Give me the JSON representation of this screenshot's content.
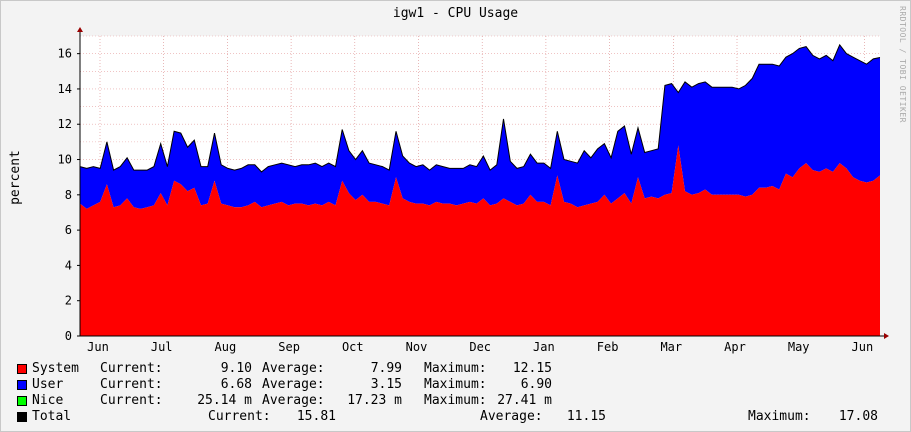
{
  "title": "igw1 - CPU Usage",
  "watermark": "RRDTOOL / TOBI OETIKER",
  "colors": {
    "system": "#ff0000",
    "user": "#0000ff",
    "nice": "#00ff00",
    "total": "#000000",
    "grid_minor": "#e6a0a0",
    "grid_major": "#d98888"
  },
  "chart_data": {
    "type": "area",
    "title": "igw1 - CPU Usage",
    "ylabel": "percent",
    "xlabel": "",
    "ylim": [
      0,
      17
    ],
    "yticks": [
      0,
      2,
      4,
      6,
      8,
      10,
      12,
      14,
      16
    ],
    "x_month_labels": [
      "Jun",
      "Jul",
      "Aug",
      "Sep",
      "Oct",
      "Nov",
      "Dec",
      "Jan",
      "Feb",
      "Mar",
      "Apr",
      "May",
      "Jun"
    ],
    "stacked": true,
    "series": [
      {
        "name": "System",
        "color": "#ff0000",
        "values": [
          7.5,
          7.2,
          7.4,
          7.6,
          8.6,
          7.3,
          7.4,
          7.8,
          7.3,
          7.2,
          7.3,
          7.4,
          8.1,
          7.4,
          8.8,
          8.6,
          8.2,
          8.4,
          7.4,
          7.5,
          8.8,
          7.5,
          7.4,
          7.3,
          7.3,
          7.4,
          7.6,
          7.3,
          7.4,
          7.5,
          7.6,
          7.4,
          7.5,
          7.5,
          7.4,
          7.5,
          7.4,
          7.6,
          7.4,
          8.8,
          8.1,
          7.7,
          8.0,
          7.6,
          7.6,
          7.5,
          7.4,
          9.0,
          7.8,
          7.6,
          7.5,
          7.5,
          7.4,
          7.6,
          7.5,
          7.5,
          7.4,
          7.5,
          7.6,
          7.5,
          7.8,
          7.4,
          7.5,
          7.8,
          7.6,
          7.4,
          7.5,
          8.0,
          7.6,
          7.6,
          7.4,
          9.1,
          7.6,
          7.5,
          7.3,
          7.4,
          7.5,
          7.6,
          8.0,
          7.5,
          7.8,
          8.1,
          7.5,
          9.0,
          7.8,
          7.9,
          7.8,
          8.0,
          8.1,
          10.8,
          8.2,
          8.0,
          8.1,
          8.3,
          8.0,
          8.0,
          8.0,
          8.0,
          8.0,
          7.9,
          8.0,
          8.4,
          8.4,
          8.5,
          8.3,
          9.2,
          9.0,
          9.5,
          9.8,
          9.4,
          9.3,
          9.5,
          9.3,
          9.8,
          9.5,
          9.0,
          8.8,
          8.7,
          8.8,
          9.1
        ]
      },
      {
        "name": "User",
        "color": "#0000ff",
        "values": [
          2.1,
          2.3,
          2.2,
          1.9,
          2.4,
          2.1,
          2.2,
          2.3,
          2.1,
          2.2,
          2.1,
          2.2,
          2.8,
          2.2,
          2.8,
          2.9,
          2.5,
          2.7,
          2.2,
          2.1,
          2.7,
          2.2,
          2.1,
          2.1,
          2.2,
          2.3,
          2.1,
          2.0,
          2.2,
          2.2,
          2.2,
          2.3,
          2.1,
          2.2,
          2.3,
          2.3,
          2.2,
          2.2,
          2.2,
          2.9,
          2.4,
          2.3,
          2.5,
          2.2,
          2.1,
          2.1,
          2.0,
          2.6,
          2.4,
          2.2,
          2.1,
          2.2,
          2.0,
          2.1,
          2.1,
          2.0,
          2.1,
          2.0,
          2.1,
          2.1,
          2.4,
          2.0,
          2.2,
          4.5,
          2.3,
          2.1,
          2.1,
          2.3,
          2.2,
          2.2,
          2.1,
          2.5,
          2.4,
          2.4,
          2.5,
          3.1,
          2.6,
          3.0,
          2.9,
          2.6,
          3.8,
          3.8,
          2.8,
          2.8,
          2.6,
          2.6,
          2.8,
          6.2,
          6.2,
          3.0,
          6.2,
          6.1,
          6.2,
          6.1,
          6.1,
          6.1,
          6.1,
          6.1,
          6.0,
          6.3,
          6.6,
          7.0,
          7.0,
          6.9,
          7.0,
          6.6,
          7.0,
          6.8,
          6.6,
          6.5,
          6.4,
          6.4,
          6.3,
          6.7,
          6.5,
          6.8,
          6.8,
          6.7,
          6.9,
          6.68
        ]
      },
      {
        "name": "Nice",
        "color": "#00ff00",
        "values": []
      }
    ]
  },
  "legend": [
    {
      "name": "System",
      "color": "#ff0000",
      "current_label": "Current:",
      "current": "9.10",
      "average_label": "Average:",
      "average": "7.99",
      "maximum_label": "Maximum:",
      "maximum": "12.15"
    },
    {
      "name": "User",
      "color": "#0000ff",
      "current_label": "Current:",
      "current": "6.68",
      "average_label": "Average:",
      "average": "3.15",
      "maximum_label": "Maximum:",
      "maximum": "6.90"
    },
    {
      "name": "Nice",
      "color": "#00ff00",
      "current_label": "Current:",
      "current": "25.14 m",
      "average_label": "Average:",
      "average": "17.23 m",
      "maximum_label": "Maximum:",
      "maximum": "27.41 m"
    },
    {
      "name": "Total",
      "color": "#000000",
      "current_label": "Current:",
      "current": "15.81",
      "average_label": "Average:",
      "average": "11.15",
      "maximum_label": "Maximum:",
      "maximum": "17.08"
    }
  ]
}
